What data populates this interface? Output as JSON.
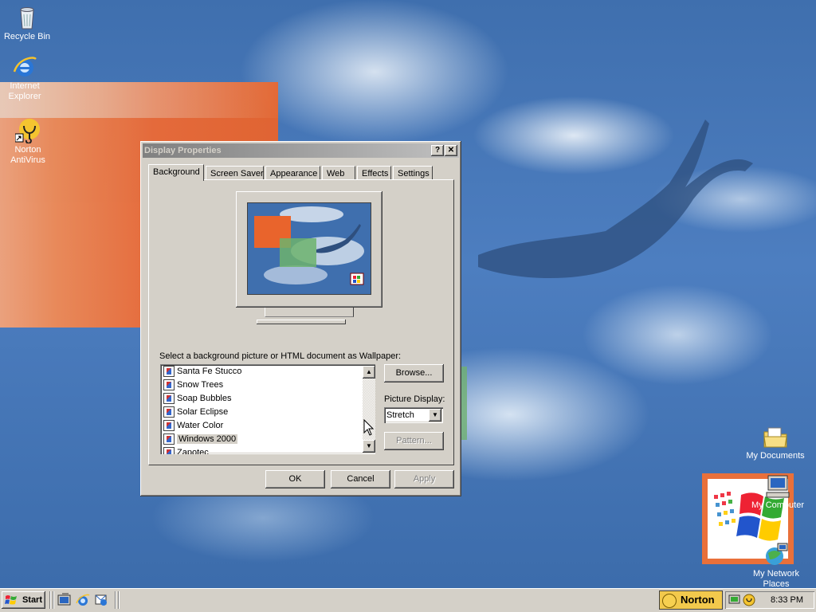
{
  "desktop": {
    "icons": [
      {
        "id": "recycle-bin",
        "label": "Recycle Bin"
      },
      {
        "id": "internet-explorer",
        "label": "Internet Explorer"
      },
      {
        "id": "norton-antivirus",
        "label": "Norton AntiVirus"
      },
      {
        "id": "my-documents",
        "label": "My Documents"
      },
      {
        "id": "my-computer",
        "label": "My Computer"
      },
      {
        "id": "my-network-places",
        "label": "My Network Places"
      }
    ]
  },
  "dialog": {
    "title": "Display Properties",
    "help_button": "?",
    "close_button": "✕",
    "tabs": [
      {
        "label": "Background",
        "active": true
      },
      {
        "label": "Screen Saver",
        "active": false
      },
      {
        "label": "Appearance",
        "active": false
      },
      {
        "label": "Web",
        "active": false
      },
      {
        "label": "Effects",
        "active": false
      },
      {
        "label": "Settings",
        "active": false
      }
    ],
    "wallpaper_prompt": "Select a background picture or HTML document as Wallpaper:",
    "wallpapers": [
      "Santa Fe Stucco",
      "Snow Trees",
      "Soap Bubbles",
      "Solar Eclipse",
      "Water Color",
      "Windows 2000",
      "Zapotec"
    ],
    "selected_wallpaper": "Windows 2000",
    "browse_button": "Browse...",
    "picture_display_label": "Picture Display:",
    "picture_display_value": "Stretch",
    "pattern_button": "Pattern...",
    "ok_button": "OK",
    "cancel_button": "Cancel",
    "apply_button": "Apply"
  },
  "taskbar": {
    "start_label": "Start",
    "norton_label": "Norton",
    "clock": "8:33 PM"
  },
  "colors": {
    "desktop_blue": "#3a6ea5",
    "face": "#d4d0c8",
    "accent_orange": "#ed6a35"
  }
}
